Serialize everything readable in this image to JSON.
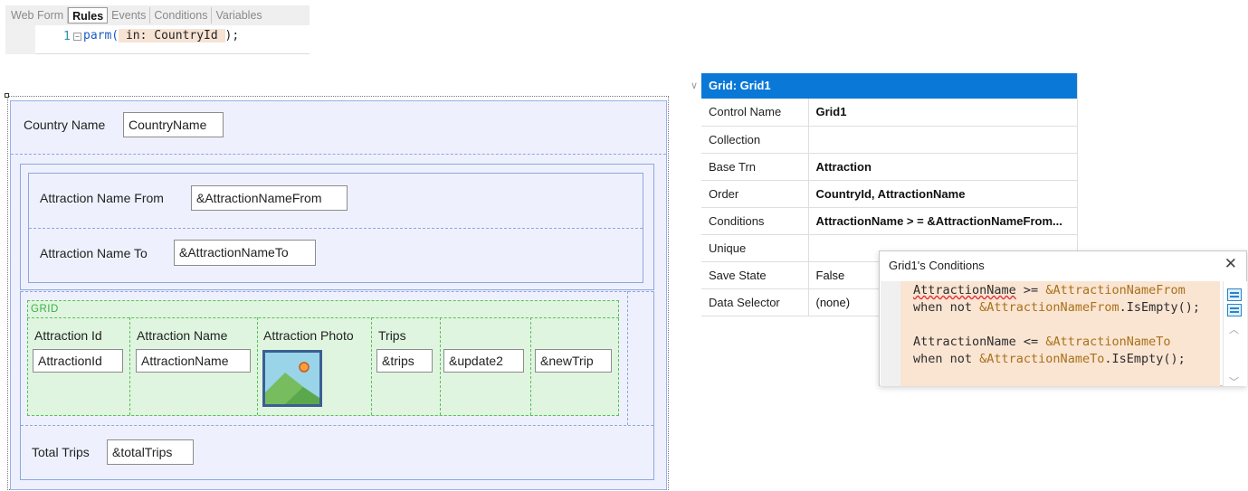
{
  "tabs": [
    {
      "label": "Web Form",
      "active": false
    },
    {
      "label": "Rules",
      "active": true
    },
    {
      "label": "Events",
      "active": false
    },
    {
      "label": "Conditions",
      "active": false
    },
    {
      "label": "Variables",
      "active": false
    }
  ],
  "rules_editor": {
    "line_number": "1",
    "fold_glyph": "⊟",
    "code_keyword": "parm(",
    "code_param": " in: CountryId ",
    "code_end": ");"
  },
  "form": {
    "country_label": "Country Name",
    "country_field": "CountryName",
    "from_label": "Attraction Name From",
    "from_field": "&AttractionNameFrom",
    "to_label": "Attraction Name To",
    "to_field": "&AttractionNameTo",
    "grid": {
      "title": "GRID",
      "columns": [
        {
          "header": "Attraction Id",
          "field": "AttractionId"
        },
        {
          "header": "Attraction Name",
          "field": "AttractionName"
        },
        {
          "header": "Attraction Photo",
          "field": ""
        },
        {
          "header": "Trips",
          "field": "&trips"
        },
        {
          "header": "",
          "field": "&update2"
        },
        {
          "header": "",
          "field": "&newTrip"
        }
      ]
    },
    "total_label": "Total Trips",
    "total_field": "&totalTrips"
  },
  "properties": {
    "header": "Grid: Grid1",
    "rows": [
      {
        "key": "Control Name",
        "value": "Grid1",
        "bold": true
      },
      {
        "key": "Collection",
        "value": "",
        "bold": false
      },
      {
        "key": "Base Trn",
        "value": "Attraction",
        "bold": true
      },
      {
        "key": "Order",
        "value": "CountryId, AttractionName",
        "bold": true
      },
      {
        "key": "Conditions",
        "value": "AttractionName > = &AttractionNameFrom...",
        "bold": true
      },
      {
        "key": "Unique",
        "value": "",
        "bold": false
      },
      {
        "key": "Save State",
        "value": "False",
        "bold": false
      },
      {
        "key": "Data Selector",
        "value": "(none)",
        "bold": false
      }
    ]
  },
  "conditions_popup": {
    "title": "Grid1's Conditions",
    "close": "✕",
    "lines": [
      {
        "a": "AttractionName",
        "b": " >= ",
        "c": "&AttractionNameFrom",
        "d": ""
      },
      {
        "a": "when not ",
        "b": "",
        "c": "&AttractionNameFrom",
        "d": ".IsEmpty();"
      },
      {
        "a": "",
        "b": "",
        "c": "",
        "d": ""
      },
      {
        "a": "AttractionName",
        "b": " <= ",
        "c": "&AttractionNameTo",
        "d": ""
      },
      {
        "a": "when not ",
        "b": "",
        "c": "&AttractionNameTo",
        "d": ".IsEmpty();"
      }
    ]
  },
  "colors": {
    "property_header": "#0a78d7",
    "grid_background": "#dff5df",
    "form_background": "#eef1fd",
    "code_highlight": "#fae4d2"
  }
}
